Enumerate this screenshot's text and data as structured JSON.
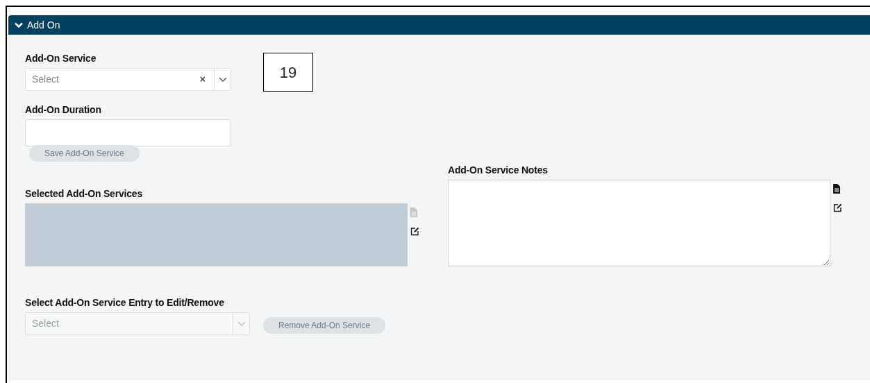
{
  "panel": {
    "title": "Add On",
    "expanded": true
  },
  "add_on_service": {
    "label": "Add-On Service",
    "placeholder": "Select",
    "clear": "×",
    "disabled": false
  },
  "callout": "19",
  "add_on_duration": {
    "label": "Add-On Duration"
  },
  "save_button": {
    "label": "Save Add-On Service",
    "disabled": true
  },
  "selected_services": {
    "label": "Selected Add-On Services",
    "disabled": true,
    "icons": [
      {
        "kind": "document",
        "disabled": true
      },
      {
        "kind": "edit",
        "disabled": false
      }
    ]
  },
  "notes": {
    "label": "Add-On Service Notes",
    "disabled": false,
    "icons": [
      {
        "kind": "document",
        "disabled": false
      },
      {
        "kind": "edit",
        "disabled": false
      }
    ]
  },
  "entry_select": {
    "label": "Select Add-On Service Entry to Edit/Remove",
    "placeholder": "Select",
    "disabled": true
  },
  "remove_button": {
    "label": "Remove Add-On Service",
    "disabled": true
  }
}
